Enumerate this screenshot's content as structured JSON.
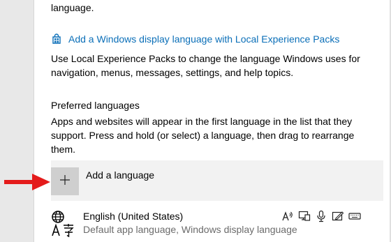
{
  "header": {
    "top_text": "language."
  },
  "lep_link": {
    "icon": "store-bag-icon",
    "label": "Add a Windows display language with Local Experience Packs"
  },
  "lep_description": "Use Local Experience Packs to change the language Windows uses for navigation, menus, messages, settings, and help topics.",
  "preferred": {
    "title": "Preferred languages",
    "description": "Apps and websites will appear in the first language in the list that they support. Press and hold (or select) a language, then drag to rearrange them.",
    "add_button": {
      "icon": "plus-icon",
      "label": "Add a language"
    },
    "languages": [
      {
        "icon": "language-icon",
        "name": "English (United States)",
        "subtitle": "Default app language, Windows display language",
        "feature_icons": [
          "text-to-speech-icon",
          "display-language-icon",
          "speech-recognition-icon",
          "handwriting-icon",
          "keyboard-icon"
        ]
      }
    ]
  },
  "annotation": {
    "arrow_color": "#e41b1b"
  },
  "colors": {
    "link": "#0b6fb8",
    "left_panel": "#e8e8e8",
    "add_row_bg": "#f2f2f2",
    "add_button_bg": "#cfcfcf"
  }
}
